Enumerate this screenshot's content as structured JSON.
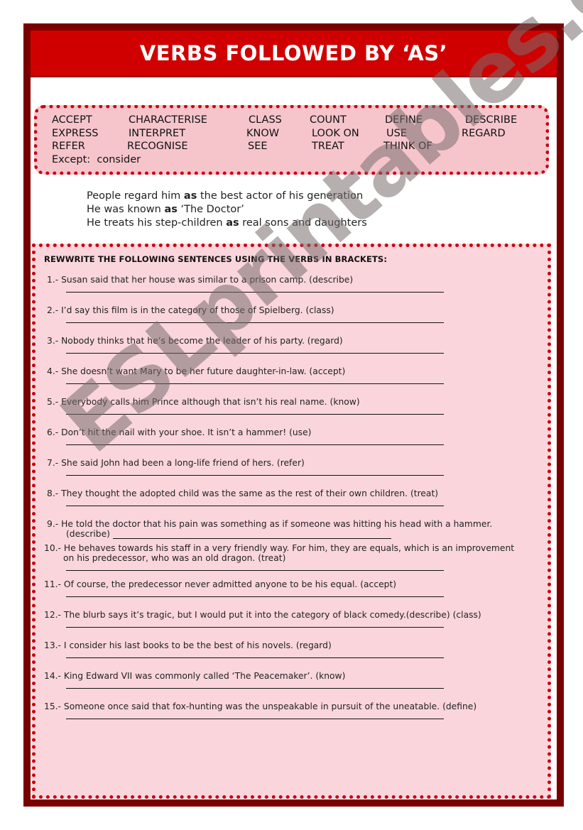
{
  "title": "VERBS FOLLOWED BY ‘AS’",
  "verb_box": {
    "rows": [
      [
        "ACCEPT",
        "CHARACTERISE",
        "CLASS",
        "COUNT",
        "DEFINE",
        "DESCRIBE"
      ],
      [
        "EXPRESS",
        "INTERPRET",
        "KNOW",
        "LOOK ON",
        "USE",
        "REGARD"
      ],
      [
        "REFER",
        "RECOGNISE",
        "SEE",
        "TREAT",
        "THINK OF"
      ]
    ],
    "except_label": "Except:",
    "except_value": "consider"
  },
  "examples": [
    {
      "before": "People regard him ",
      "keyword": "as",
      "after": " the best actor of his generation"
    },
    {
      "before": "He was known ",
      "keyword": "as",
      "after": " ‘The Doctor’"
    },
    {
      "before": "He treats his step-children ",
      "keyword": "as",
      "after": " real sons and daughters"
    }
  ],
  "exercise": {
    "instruction": "REWWRITE THE FOLLOWING SENTENCES USING THE VERBS IN BRACKETS:",
    "items": [
      {
        "number": "1.-",
        "text": "Susan said that her house was similar to a prison camp.   (describe)"
      },
      {
        "number": "2.-",
        "text": "I’d say this film is in the category of those of Spielberg.  (class)"
      },
      {
        "number": "3.-",
        "text": "Nobody thinks that he’s become the leader of his party.  (regard)"
      },
      {
        "number": "4.-",
        "text": "She doesn’t want Mary to be her future daughter-in-law.   (accept)"
      },
      {
        "number": "5.-",
        "text": "Everybody calls him Prince although that isn’t his real name.   (know)"
      },
      {
        "number": "6.-",
        "text": "Don’t hit the nail with your shoe. It isn’t a hammer!   (use)"
      },
      {
        "number": "7.-",
        "text": "She said John had been a long-life friend of hers.   (refer)"
      },
      {
        "number": "8.-",
        "text": "They thought the adopted child was the same as the rest of their own children. (treat)"
      },
      {
        "number": "9.-",
        "text": "He told the doctor that his pain was something as if someone was hitting his head with a hammer.",
        "continuation": "(describe)"
      },
      {
        "number": "10.-",
        "text": "He behaves towards his staff  in a very friendly way. For him, they are equals, which is an improvement",
        "continuation": "on his predecessor, who was an old dragon.   (treat)"
      },
      {
        "number": "11.-",
        "text": "Of course, the predecessor never admitted anyone to be his equal.  (accept)"
      },
      {
        "number": "12.-",
        "text": "The blurb says it’s tragic, but I would put it into the category of black comedy.(describe)   (class)"
      },
      {
        "number": "13.-",
        "text": "I consider his last books to be the best of his novels.   (regard)"
      },
      {
        "number": "14.-",
        "text": "King Edward VII was commonly called ‘The Peacemaker’.   (know)"
      },
      {
        "number": "15.-",
        "text": "Someone once said that fox-hunting was the unspeakable in pursuit of the uneatable. (define)"
      }
    ]
  },
  "watermark": "ESLprintables.com",
  "colors": {
    "frame": "#7a0000",
    "title_bar": "#d00000",
    "dotted_border": "#c80010",
    "verb_box_bg": "#f6c5cc",
    "exercise_bg": "#fad6dc"
  }
}
